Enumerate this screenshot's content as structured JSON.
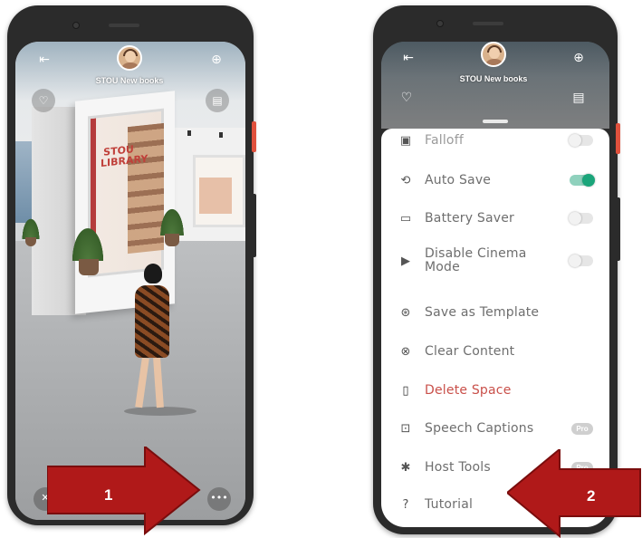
{
  "left_phone": {
    "space_title": "STOU New books",
    "poster_text": "STOU LIBRARY",
    "icons": {
      "exit": "exit-icon",
      "invite": "add-person-icon",
      "like": "heart-icon",
      "chat": "chat-icon",
      "mute": "microphone-off-icon",
      "more": "more-dots-icon"
    },
    "more_button_glyph": "•••"
  },
  "right_phone": {
    "space_title": "STOU New books",
    "menu_items": [
      {
        "label": "Spatial Audio Falloff",
        "icon": "speaker-icon",
        "control": "toggle",
        "state": "off"
      },
      {
        "label": "Auto Save",
        "icon": "auto-save-icon",
        "control": "toggle",
        "state": "on"
      },
      {
        "label": "Battery Saver",
        "icon": "battery-icon",
        "control": "toggle",
        "state": "off"
      },
      {
        "label": "Disable Cinema Mode",
        "icon": "play-icon",
        "control": "toggle",
        "state": "off"
      },
      {
        "label": "Save as Template",
        "icon": "template-icon",
        "control": "none"
      },
      {
        "label": "Clear Content",
        "icon": "clear-icon",
        "control": "none"
      },
      {
        "label": "Delete Space",
        "icon": "trash-icon",
        "control": "none",
        "danger": true
      },
      {
        "label": "Speech Captions",
        "icon": "captions-icon",
        "control": "pro"
      },
      {
        "label": "Host Tools",
        "icon": "host-tools-icon",
        "control": "pro"
      },
      {
        "label": "Tutorial",
        "icon": "help-icon",
        "control": "none"
      }
    ],
    "pro_label": "Pro",
    "visible_labels": {
      "spatial_partial": "Falloff",
      "cinema_line1": "Disable Cinema",
      "cinema_line2": "Mode"
    }
  },
  "annotations": {
    "arrow_1": "1",
    "arrow_2": "2",
    "arrow_color": "#b01919"
  }
}
